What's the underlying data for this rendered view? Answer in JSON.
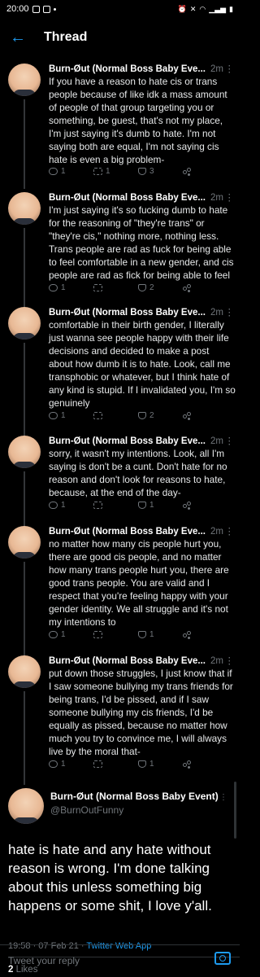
{
  "statusbar": {
    "time": "20:00"
  },
  "header": {
    "title": "Thread"
  },
  "tweets": [
    {
      "name": "Burn-Øut (Normal Boss Baby Eve...",
      "time": "2m",
      "text": "If you have a reason to hate cis or trans people because of like idk a mass amount of people of that group targeting you or something, be guest, that's not my place, I'm just saying it's dumb to hate. I'm not saying both are equal, I'm not saying cis hate is even a big problem-",
      "replies": "1",
      "retweets": "1",
      "likes": "3"
    },
    {
      "name": "Burn-Øut (Normal Boss Baby Eve...",
      "time": "2m",
      "text": "I'm just saying it's so fucking dumb to hate for the reasoning of \"they're trans\" or \"they're cis,\" nothing more, nothing less. Trans people are rad as fuck for being able to feel comfortable in a new gender, and cis people are rad as fick for being able to feel",
      "replies": "1",
      "retweets": "",
      "likes": "2"
    },
    {
      "name": "Burn-Øut (Normal Boss Baby Eve...",
      "time": "2m",
      "text": "comfortable in their birth gender, I literally just wanna see people happy with their life decisions and decided to make a post about how dumb it is to hate. Look, call me transphobic or whatever, but I think hate of any kind is stupid. If I invalidated you, I'm so genuinely",
      "replies": "1",
      "retweets": "",
      "likes": "2"
    },
    {
      "name": "Burn-Øut (Normal Boss Baby Eve...",
      "time": "2m",
      "text": "sorry, it wasn't my intentions. Look, all I'm saying is don't be a cunt. Don't hate for no reason and don't look for reasons to hate, because, at the end of the day-",
      "replies": "1",
      "retweets": "",
      "likes": "1"
    },
    {
      "name": "Burn-Øut (Normal Boss Baby Eve...",
      "time": "2m",
      "text": "no matter how many cis people hurt you, there are good cis people, and no matter how many trans people hurt you, there are good trans people. You are valid and I respect that you're feeling happy with your gender identity. We all struggle and it's not my intentions to",
      "replies": "1",
      "retweets": "",
      "likes": "1"
    },
    {
      "name": "Burn-Øut (Normal Boss Baby Eve...",
      "time": "2m",
      "text": "put down those struggles, I just know that if I saw someone bullying my trans friends for being trans, I'd be pissed, and if I saw someone bullying my cis friends, I'd be equally as pissed, because no matter how much you try to convince me, I will always live by the moral that-",
      "replies": "1",
      "retweets": "",
      "likes": "1"
    }
  ],
  "main_tweet": {
    "name": "Burn-Øut (Normal Boss Baby Event)",
    "handle": "@BurnOutFunny",
    "text": "hate is hate and any hate without reason is wrong. I'm done talking about this unless something big happens or some shit, I love y'all.",
    "timestamp": "19:58 · 07 Feb 21 · ",
    "client": "Twitter Web App",
    "likes_count": "2",
    "likes_label": "Likes"
  },
  "reply": {
    "placeholder": "Tweet your reply"
  },
  "colors": {
    "accent": "#1d9bf0",
    "background": "#000000",
    "secondary_text": "#71767b"
  },
  "icons": [
    "back-arrow-icon",
    "reply-icon",
    "retweet-icon",
    "like-icon",
    "share-icon",
    "camera-icon",
    "more-icon"
  ]
}
